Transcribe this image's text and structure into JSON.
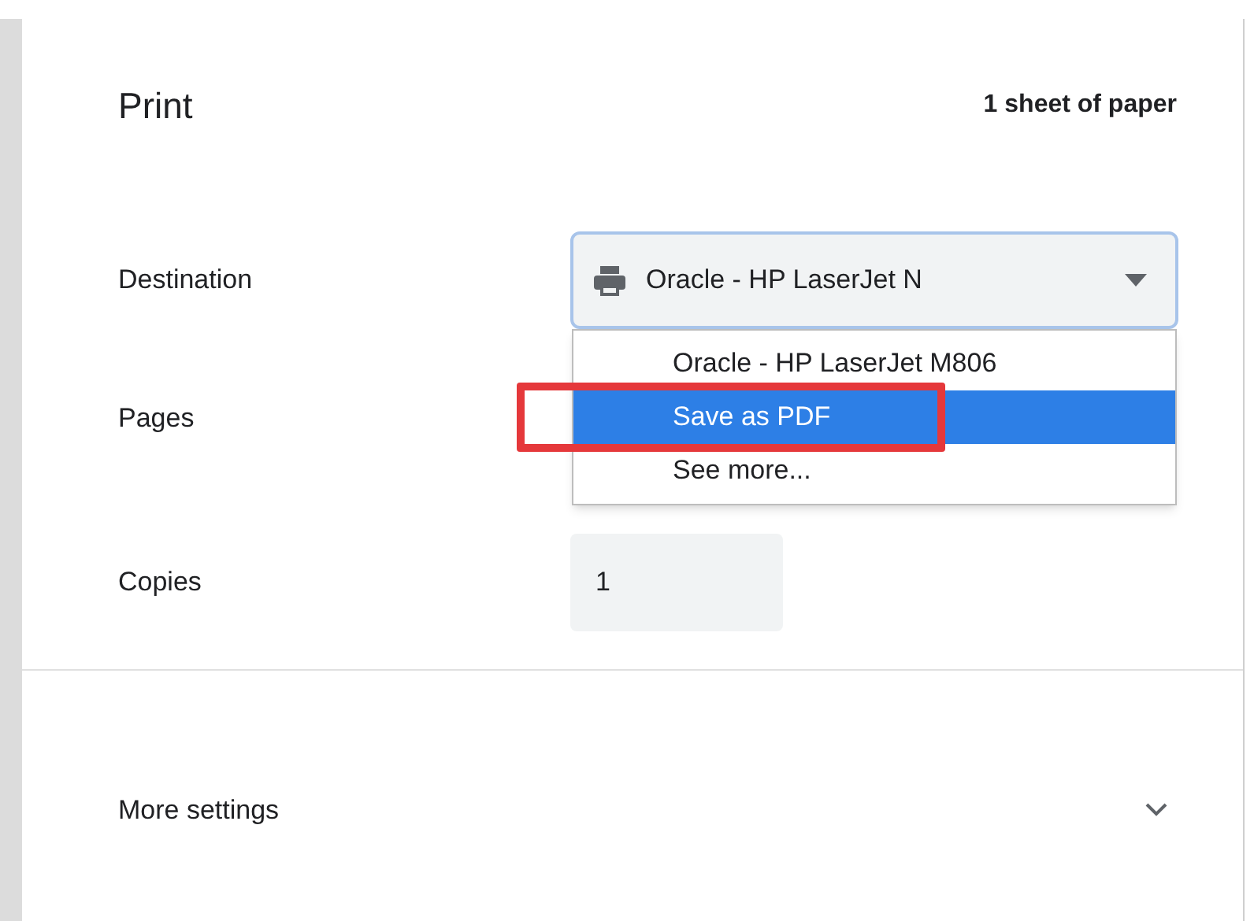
{
  "title": "Print",
  "summary": "1 sheet of paper",
  "destination": {
    "label": "Destination",
    "value": "Oracle - HP LaserJet N",
    "expanded": true,
    "options": [
      {
        "label": "Oracle - HP LaserJet M806",
        "selected": false
      },
      {
        "label": "Save as PDF",
        "selected": true
      },
      {
        "label": "See more...",
        "selected": false
      }
    ]
  },
  "pages": {
    "label": "Pages"
  },
  "copies": {
    "label": "Copies",
    "value": "1"
  },
  "more_settings": {
    "label": "More settings",
    "expanded": false
  }
}
